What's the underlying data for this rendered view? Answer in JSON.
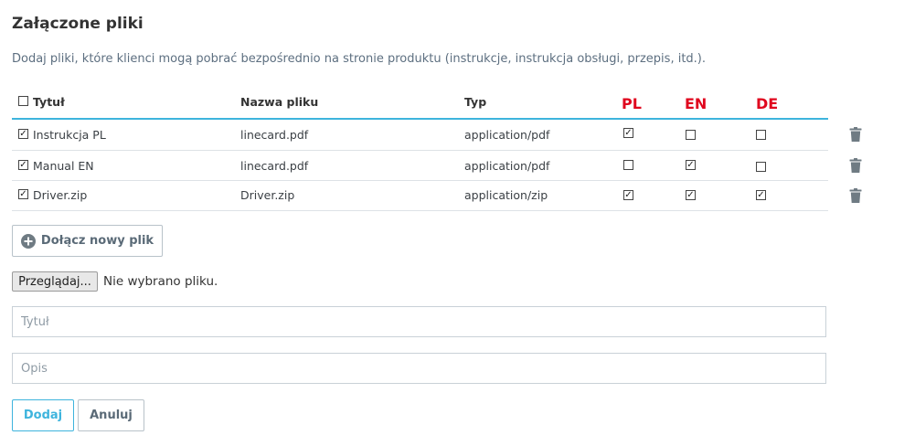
{
  "page": {
    "title": "Załączone pliki",
    "subtitle": "Dodaj pliki, które klienci mogą pobrać bezpośrednio na stronie produktu (instrukcje, instrukcja obsługi, przepis, itd.)."
  },
  "table": {
    "headers": {
      "title": "Tytuł",
      "filename": "Nazwa pliku",
      "type": "Typ",
      "pl": "PL",
      "en": "EN",
      "de": "DE"
    },
    "select_all_checked": false,
    "rows": [
      {
        "checked": true,
        "title": "Instrukcja PL",
        "filename": "linecard.pdf",
        "type": "application/pdf",
        "pl": true,
        "en": false,
        "de": false
      },
      {
        "checked": true,
        "title": "Manual EN",
        "filename": "linecard.pdf",
        "type": "application/pdf",
        "pl": false,
        "en": true,
        "de": false
      },
      {
        "checked": true,
        "title": "Driver.zip",
        "filename": "Driver.zip",
        "type": "application/zip",
        "pl": true,
        "en": true,
        "de": true
      }
    ],
    "row_action_icon": "trash-icon"
  },
  "attach": {
    "button_label": "Dołącz nowy plik",
    "icon": "plus-circle-icon"
  },
  "file_input": {
    "browse_label": "Przeglądaj...",
    "status": "Nie wybrano pliku."
  },
  "form": {
    "title_placeholder": "Tytuł",
    "title_value": "",
    "description_placeholder": "Opis",
    "description_value": "",
    "add_label": "Dodaj",
    "cancel_label": "Anuluj"
  },
  "colors": {
    "accent": "#3eb4dd",
    "language_header": "#e0071e",
    "icon_gray": "#6f7b83"
  }
}
